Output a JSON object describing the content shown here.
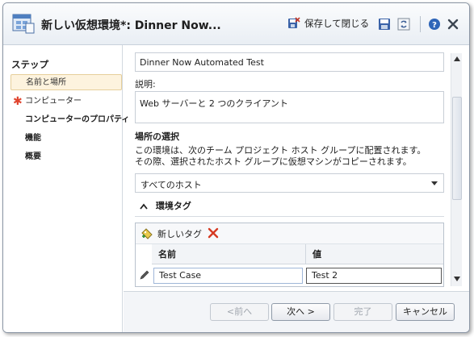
{
  "window": {
    "title": "新しい仮想環境*: Dinner Now...",
    "save_close_label": "保存して閉じる"
  },
  "nav": {
    "heading": "ステップ",
    "items": [
      {
        "label": "名前と場所",
        "selected": true,
        "required": false
      },
      {
        "label": "コンピューター",
        "selected": false,
        "required": true
      },
      {
        "label": "コンピューターのプロパティ",
        "selected": false,
        "required": false
      },
      {
        "label": "機能",
        "selected": false,
        "required": false
      },
      {
        "label": "概要",
        "selected": false,
        "required": false
      }
    ]
  },
  "form": {
    "name_value": "Dinner Now Automated Test",
    "description_label": "説明:",
    "description_value": "Web サーバーと 2 つのクライアント",
    "location_label": "場所の選択",
    "location_text_1": "この環境は、次のチーム プロジェクト ホスト グループに配置されます。",
    "location_text_2": "その際、選択されたホスト グループに仮想マシンがコピーされます。",
    "host_group_selected": "すべてのホスト",
    "tags_section_label": "環境タグ",
    "new_tag_label": "新しいタグ",
    "columns": {
      "name": "名前",
      "value": "値"
    },
    "tag_row": {
      "name": "Test Case",
      "value": "Test 2"
    }
  },
  "footer": {
    "back": "<前へ",
    "next": "次へ >",
    "finish": "完了",
    "cancel": "キャンセル"
  },
  "colors": {
    "accent": "#2b6cc4",
    "required": "#e0452f",
    "selected_bg": "#fdf3de"
  }
}
